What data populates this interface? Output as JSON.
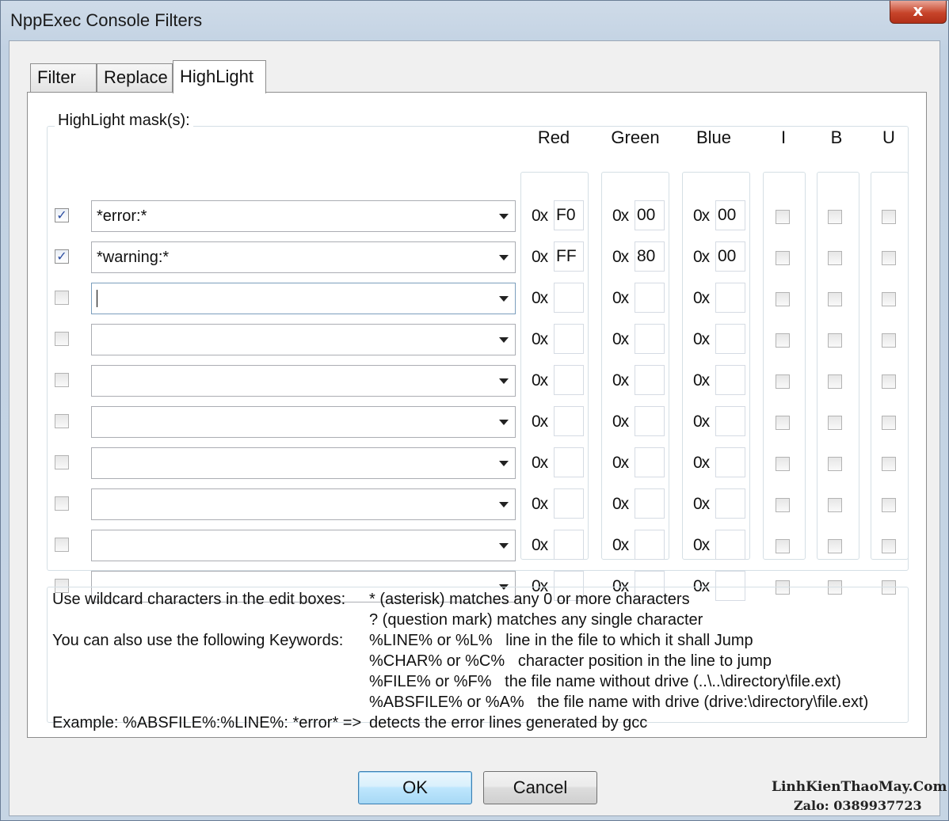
{
  "window": {
    "title": "NppExec Console Filters",
    "close_label": "x"
  },
  "tabs": [
    {
      "label": "Filter",
      "active": false
    },
    {
      "label": "Replace",
      "active": false
    },
    {
      "label": "HighLight",
      "active": true
    }
  ],
  "highlight": {
    "group_label": "HighLight mask(s):",
    "columns": {
      "red": "Red",
      "green": "Green",
      "blue": "Blue",
      "italic": "I",
      "bold": "B",
      "underline": "U"
    },
    "hex_prefix": "0x",
    "rows": [
      {
        "enabled": true,
        "mask": "*error:*",
        "red": "F0",
        "green": "00",
        "blue": "00",
        "italic": false,
        "bold": false,
        "underline": false
      },
      {
        "enabled": true,
        "mask": "*warning:*",
        "red": "FF",
        "green": "80",
        "blue": "00",
        "italic": false,
        "bold": false,
        "underline": false
      },
      {
        "enabled": false,
        "mask": "",
        "red": "",
        "green": "",
        "blue": "",
        "italic": false,
        "bold": false,
        "underline": false
      },
      {
        "enabled": false,
        "mask": "",
        "red": "",
        "green": "",
        "blue": "",
        "italic": false,
        "bold": false,
        "underline": false
      },
      {
        "enabled": false,
        "mask": "",
        "red": "",
        "green": "",
        "blue": "",
        "italic": false,
        "bold": false,
        "underline": false
      },
      {
        "enabled": false,
        "mask": "",
        "red": "",
        "green": "",
        "blue": "",
        "italic": false,
        "bold": false,
        "underline": false
      },
      {
        "enabled": false,
        "mask": "",
        "red": "",
        "green": "",
        "blue": "",
        "italic": false,
        "bold": false,
        "underline": false
      },
      {
        "enabled": false,
        "mask": "",
        "red": "",
        "green": "",
        "blue": "",
        "italic": false,
        "bold": false,
        "underline": false
      },
      {
        "enabled": false,
        "mask": "",
        "red": "",
        "green": "",
        "blue": "",
        "italic": false,
        "bold": false,
        "underline": false
      },
      {
        "enabled": false,
        "mask": "",
        "red": "",
        "green": "",
        "blue": "",
        "italic": false,
        "bold": false,
        "underline": false
      }
    ]
  },
  "help": {
    "lines": [
      {
        "label": "Use wildcard characters in the edit boxes:",
        "text": "* (asterisk) matches any 0 or more characters"
      },
      {
        "label": "",
        "text": "? (question mark) matches any single character"
      },
      {
        "label": "You can also use the following Keywords:",
        "text": "%LINE% or %L%   line in the file to which it shall Jump"
      },
      {
        "label": "",
        "text": "%CHAR% or %C%   character position in the line to jump"
      },
      {
        "label": "",
        "text": "%FILE% or %F%   the file name without drive (..\\..\\directory\\file.ext)"
      },
      {
        "label": "",
        "text": "%ABSFILE% or %A%   the file name with drive (drive:\\directory\\file.ext)"
      },
      {
        "label": "Example: %ABSFILE%:%LINE%: *error* =>",
        "text": "detects the error lines generated by gcc"
      }
    ]
  },
  "buttons": {
    "ok": "OK",
    "cancel": "Cancel"
  },
  "watermark": {
    "line1": "LinhKienThaoMay.Com",
    "line2": "Zalo: 0389937723"
  }
}
